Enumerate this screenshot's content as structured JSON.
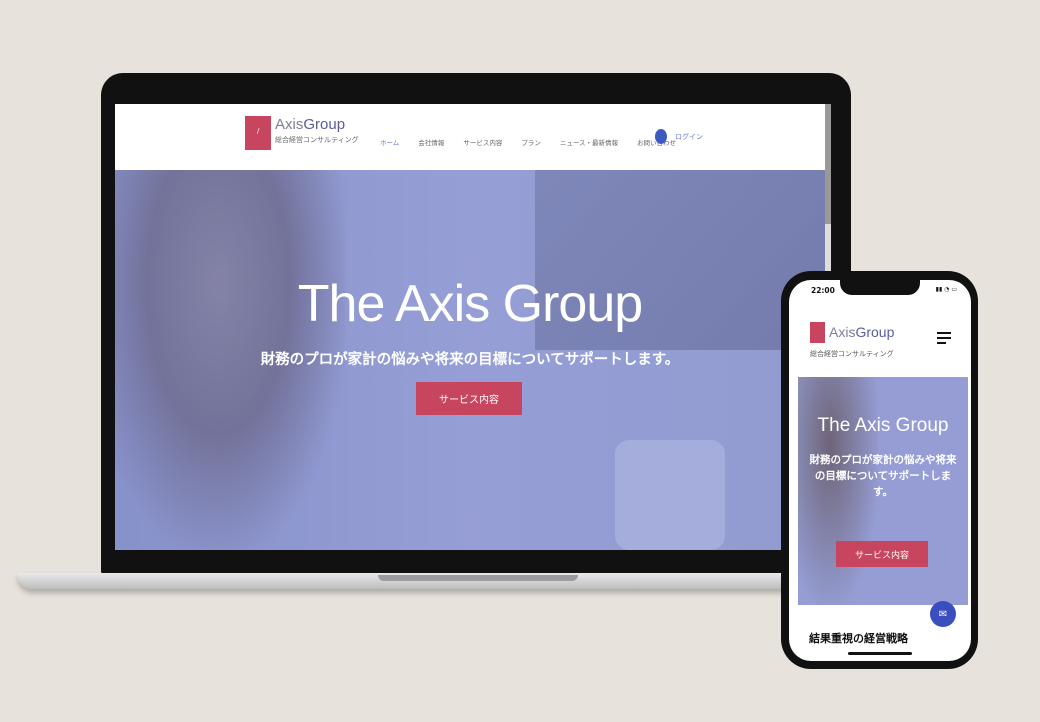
{
  "desktop": {
    "brand": {
      "part1": "Axis",
      "part2": "Group",
      "tagline": "総合経営コンサルティング",
      "logo_mark": "/"
    },
    "nav": [
      "ホーム",
      "会社情報",
      "サービス内容",
      "プラン",
      "ニュース・最新情報",
      "お問い合わせ"
    ],
    "login": "ログイン",
    "hero": {
      "title": "The Axis Group",
      "subtitle": "財務のプロが家計の悩みや将来の目標についてサポートします。",
      "button": "サービス内容"
    }
  },
  "mobile": {
    "status_time": "22:00",
    "status_icons": "▮▮ ◔ ▭",
    "brand": {
      "part1": "Axis",
      "part2": "Group",
      "tagline": "総合経営コンサルティング"
    },
    "hero": {
      "title": "The Axis Group",
      "subtitle": "財務のプロが家計の悩みや将来の目標についてサポートします。",
      "button": "サービス内容"
    },
    "chat_icon": "✉",
    "section_title": "結果重視の経営戦略"
  },
  "colors": {
    "accent": "#c7455f",
    "brand": "#5a5a9c",
    "background": "#e7e2db",
    "chat": "#3a4fbf"
  }
}
